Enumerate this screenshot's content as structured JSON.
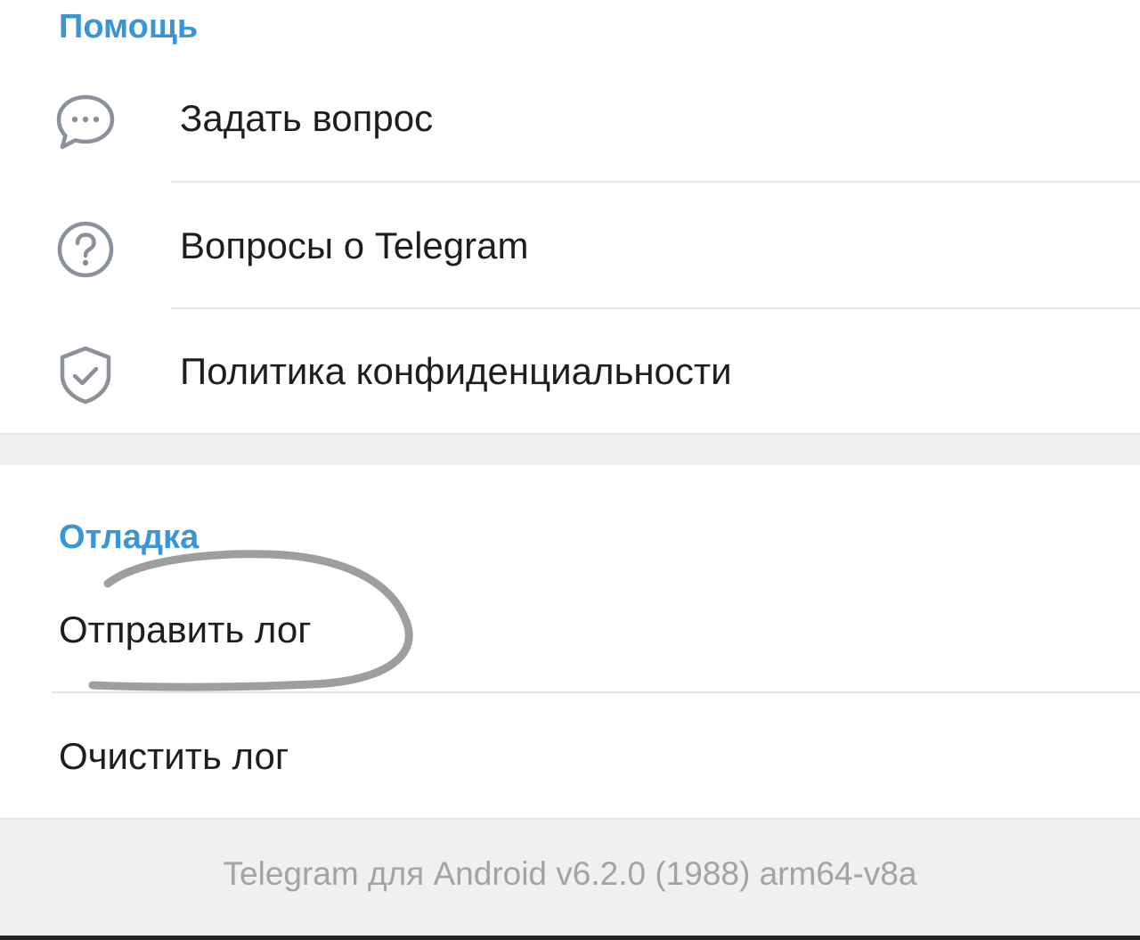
{
  "help": {
    "header": "Помощь",
    "items": [
      {
        "label": "Задать вопрос",
        "icon": "chat-bubble-icon"
      },
      {
        "label": "Вопросы о Telegram",
        "icon": "question-circle-icon"
      },
      {
        "label": "Политика конфиденциальности",
        "icon": "shield-check-icon"
      }
    ]
  },
  "debug": {
    "header": "Отладка",
    "items": [
      {
        "label": "Отправить лог"
      },
      {
        "label": "Очистить лог"
      }
    ]
  },
  "footer": {
    "version": "Telegram для Android v6.2.0 (1988) arm64-v8a"
  },
  "colors": {
    "accent": "#3a95d4",
    "icon": "#8a9199",
    "text": "#1e1e1e",
    "annotation": "#9e9e9e"
  }
}
